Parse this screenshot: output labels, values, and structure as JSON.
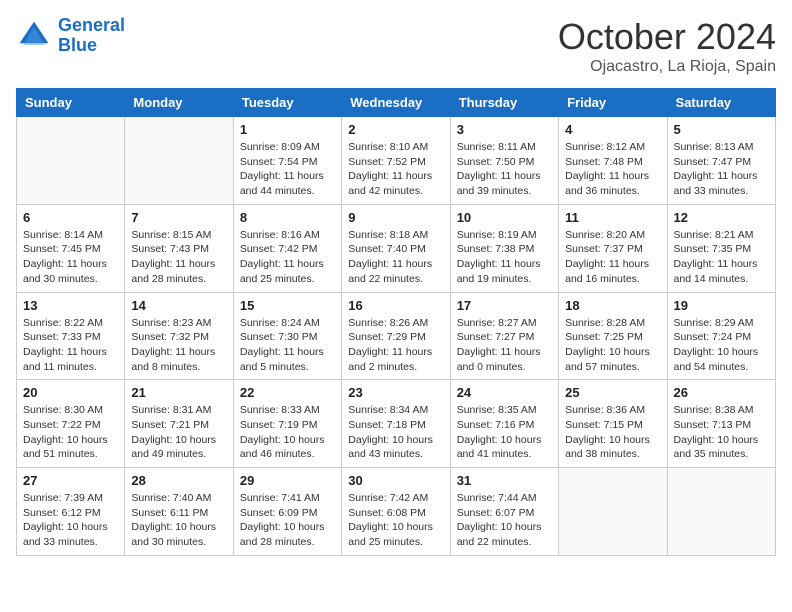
{
  "header": {
    "logo_line1": "General",
    "logo_line2": "Blue",
    "month": "October 2024",
    "location": "Ojacastro, La Rioja, Spain"
  },
  "days_of_week": [
    "Sunday",
    "Monday",
    "Tuesday",
    "Wednesday",
    "Thursday",
    "Friday",
    "Saturday"
  ],
  "weeks": [
    [
      {
        "day": "",
        "sunrise": "",
        "sunset": "",
        "daylight": "",
        "empty": true
      },
      {
        "day": "",
        "sunrise": "",
        "sunset": "",
        "daylight": "",
        "empty": true
      },
      {
        "day": "1",
        "sunrise": "Sunrise: 8:09 AM",
        "sunset": "Sunset: 7:54 PM",
        "daylight": "Daylight: 11 hours and 44 minutes."
      },
      {
        "day": "2",
        "sunrise": "Sunrise: 8:10 AM",
        "sunset": "Sunset: 7:52 PM",
        "daylight": "Daylight: 11 hours and 42 minutes."
      },
      {
        "day": "3",
        "sunrise": "Sunrise: 8:11 AM",
        "sunset": "Sunset: 7:50 PM",
        "daylight": "Daylight: 11 hours and 39 minutes."
      },
      {
        "day": "4",
        "sunrise": "Sunrise: 8:12 AM",
        "sunset": "Sunset: 7:48 PM",
        "daylight": "Daylight: 11 hours and 36 minutes."
      },
      {
        "day": "5",
        "sunrise": "Sunrise: 8:13 AM",
        "sunset": "Sunset: 7:47 PM",
        "daylight": "Daylight: 11 hours and 33 minutes."
      }
    ],
    [
      {
        "day": "6",
        "sunrise": "Sunrise: 8:14 AM",
        "sunset": "Sunset: 7:45 PM",
        "daylight": "Daylight: 11 hours and 30 minutes."
      },
      {
        "day": "7",
        "sunrise": "Sunrise: 8:15 AM",
        "sunset": "Sunset: 7:43 PM",
        "daylight": "Daylight: 11 hours and 28 minutes."
      },
      {
        "day": "8",
        "sunrise": "Sunrise: 8:16 AM",
        "sunset": "Sunset: 7:42 PM",
        "daylight": "Daylight: 11 hours and 25 minutes."
      },
      {
        "day": "9",
        "sunrise": "Sunrise: 8:18 AM",
        "sunset": "Sunset: 7:40 PM",
        "daylight": "Daylight: 11 hours and 22 minutes."
      },
      {
        "day": "10",
        "sunrise": "Sunrise: 8:19 AM",
        "sunset": "Sunset: 7:38 PM",
        "daylight": "Daylight: 11 hours and 19 minutes."
      },
      {
        "day": "11",
        "sunrise": "Sunrise: 8:20 AM",
        "sunset": "Sunset: 7:37 PM",
        "daylight": "Daylight: 11 hours and 16 minutes."
      },
      {
        "day": "12",
        "sunrise": "Sunrise: 8:21 AM",
        "sunset": "Sunset: 7:35 PM",
        "daylight": "Daylight: 11 hours and 14 minutes."
      }
    ],
    [
      {
        "day": "13",
        "sunrise": "Sunrise: 8:22 AM",
        "sunset": "Sunset: 7:33 PM",
        "daylight": "Daylight: 11 hours and 11 minutes."
      },
      {
        "day": "14",
        "sunrise": "Sunrise: 8:23 AM",
        "sunset": "Sunset: 7:32 PM",
        "daylight": "Daylight: 11 hours and 8 minutes."
      },
      {
        "day": "15",
        "sunrise": "Sunrise: 8:24 AM",
        "sunset": "Sunset: 7:30 PM",
        "daylight": "Daylight: 11 hours and 5 minutes."
      },
      {
        "day": "16",
        "sunrise": "Sunrise: 8:26 AM",
        "sunset": "Sunset: 7:29 PM",
        "daylight": "Daylight: 11 hours and 2 minutes."
      },
      {
        "day": "17",
        "sunrise": "Sunrise: 8:27 AM",
        "sunset": "Sunset: 7:27 PM",
        "daylight": "Daylight: 11 hours and 0 minutes."
      },
      {
        "day": "18",
        "sunrise": "Sunrise: 8:28 AM",
        "sunset": "Sunset: 7:25 PM",
        "daylight": "Daylight: 10 hours and 57 minutes."
      },
      {
        "day": "19",
        "sunrise": "Sunrise: 8:29 AM",
        "sunset": "Sunset: 7:24 PM",
        "daylight": "Daylight: 10 hours and 54 minutes."
      }
    ],
    [
      {
        "day": "20",
        "sunrise": "Sunrise: 8:30 AM",
        "sunset": "Sunset: 7:22 PM",
        "daylight": "Daylight: 10 hours and 51 minutes."
      },
      {
        "day": "21",
        "sunrise": "Sunrise: 8:31 AM",
        "sunset": "Sunset: 7:21 PM",
        "daylight": "Daylight: 10 hours and 49 minutes."
      },
      {
        "day": "22",
        "sunrise": "Sunrise: 8:33 AM",
        "sunset": "Sunset: 7:19 PM",
        "daylight": "Daylight: 10 hours and 46 minutes."
      },
      {
        "day": "23",
        "sunrise": "Sunrise: 8:34 AM",
        "sunset": "Sunset: 7:18 PM",
        "daylight": "Daylight: 10 hours and 43 minutes."
      },
      {
        "day": "24",
        "sunrise": "Sunrise: 8:35 AM",
        "sunset": "Sunset: 7:16 PM",
        "daylight": "Daylight: 10 hours and 41 minutes."
      },
      {
        "day": "25",
        "sunrise": "Sunrise: 8:36 AM",
        "sunset": "Sunset: 7:15 PM",
        "daylight": "Daylight: 10 hours and 38 minutes."
      },
      {
        "day": "26",
        "sunrise": "Sunrise: 8:38 AM",
        "sunset": "Sunset: 7:13 PM",
        "daylight": "Daylight: 10 hours and 35 minutes."
      }
    ],
    [
      {
        "day": "27",
        "sunrise": "Sunrise: 7:39 AM",
        "sunset": "Sunset: 6:12 PM",
        "daylight": "Daylight: 10 hours and 33 minutes."
      },
      {
        "day": "28",
        "sunrise": "Sunrise: 7:40 AM",
        "sunset": "Sunset: 6:11 PM",
        "daylight": "Daylight: 10 hours and 30 minutes."
      },
      {
        "day": "29",
        "sunrise": "Sunrise: 7:41 AM",
        "sunset": "Sunset: 6:09 PM",
        "daylight": "Daylight: 10 hours and 28 minutes."
      },
      {
        "day": "30",
        "sunrise": "Sunrise: 7:42 AM",
        "sunset": "Sunset: 6:08 PM",
        "daylight": "Daylight: 10 hours and 25 minutes."
      },
      {
        "day": "31",
        "sunrise": "Sunrise: 7:44 AM",
        "sunset": "Sunset: 6:07 PM",
        "daylight": "Daylight: 10 hours and 22 minutes."
      },
      {
        "day": "",
        "sunrise": "",
        "sunset": "",
        "daylight": "",
        "empty": true
      },
      {
        "day": "",
        "sunrise": "",
        "sunset": "",
        "daylight": "",
        "empty": true
      }
    ]
  ]
}
